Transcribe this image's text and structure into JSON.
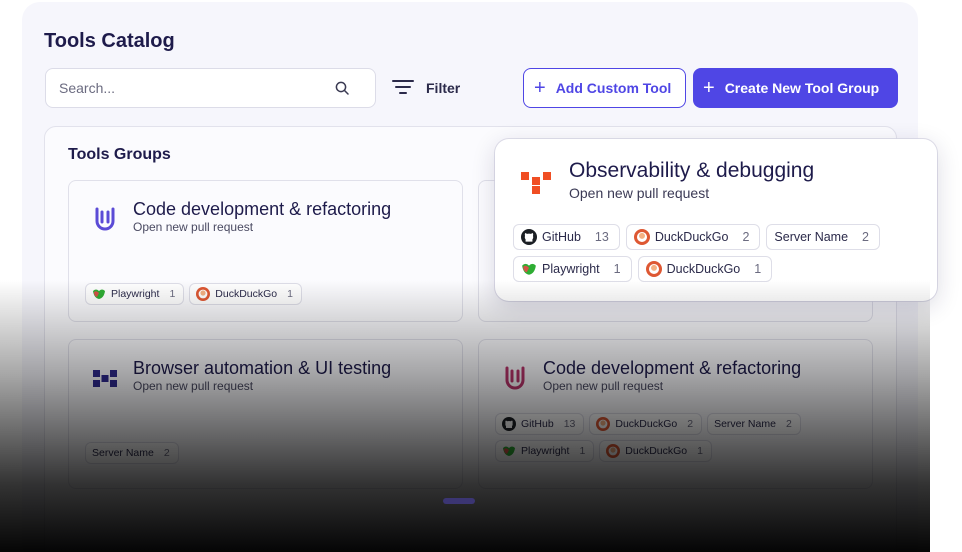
{
  "header": {
    "title": "Tools Catalog",
    "search_placeholder": "Search...",
    "filter_label": "Filter",
    "add_custom_tool_label": "Add Custom Tool",
    "create_group_label": "Create New Tool Group"
  },
  "groups": {
    "title": "Tools Groups",
    "cards": [
      {
        "title": "Code development & refactoring",
        "subtitle": "Open new pull request",
        "chips": [
          {
            "name": "Playwright",
            "count": "1",
            "icon": "playwright-icon"
          },
          {
            "name": "DuckDuckGo",
            "count": "1",
            "icon": "duckduckgo-icon"
          }
        ]
      },
      {
        "title": "Browser automation & UI testing",
        "subtitle": "Open new pull request",
        "chips": [
          {
            "name": "Server Name",
            "count": "2",
            "icon": ""
          }
        ]
      },
      {
        "title": "Code development & refactoring",
        "subtitle": "Open new pull request",
        "chips": [
          {
            "name": "GitHub",
            "count": "13",
            "icon": "github-icon"
          },
          {
            "name": "DuckDuckGo",
            "count": "2",
            "icon": "duckduckgo-icon"
          },
          {
            "name": "Server Name",
            "count": "2",
            "icon": ""
          },
          {
            "name": "Playwright",
            "count": "1",
            "icon": "playwright-icon"
          },
          {
            "name": "DuckDuckGo",
            "count": "1",
            "icon": "duckduckgo-icon"
          }
        ]
      }
    ]
  },
  "popup": {
    "title": "Observability & debugging",
    "subtitle": "Open new pull request",
    "chips": [
      {
        "name": "GitHub",
        "count": "13",
        "icon": "github-icon"
      },
      {
        "name": "DuckDuckGo",
        "count": "2",
        "icon": "duckduckgo-icon"
      },
      {
        "name": "Server Name",
        "count": "2",
        "icon": ""
      },
      {
        "name": "Playwright",
        "count": "1",
        "icon": "playwright-icon"
      },
      {
        "name": "DuckDuckGo",
        "count": "1",
        "icon": "duckduckgo-icon"
      }
    ]
  },
  "colors": {
    "accent": "#4f46e5",
    "logo_purple": "#5b4bd6",
    "logo_pink": "#b8336a",
    "logo_orange": "#f04e23",
    "logo_navy": "#2f2a8f"
  }
}
